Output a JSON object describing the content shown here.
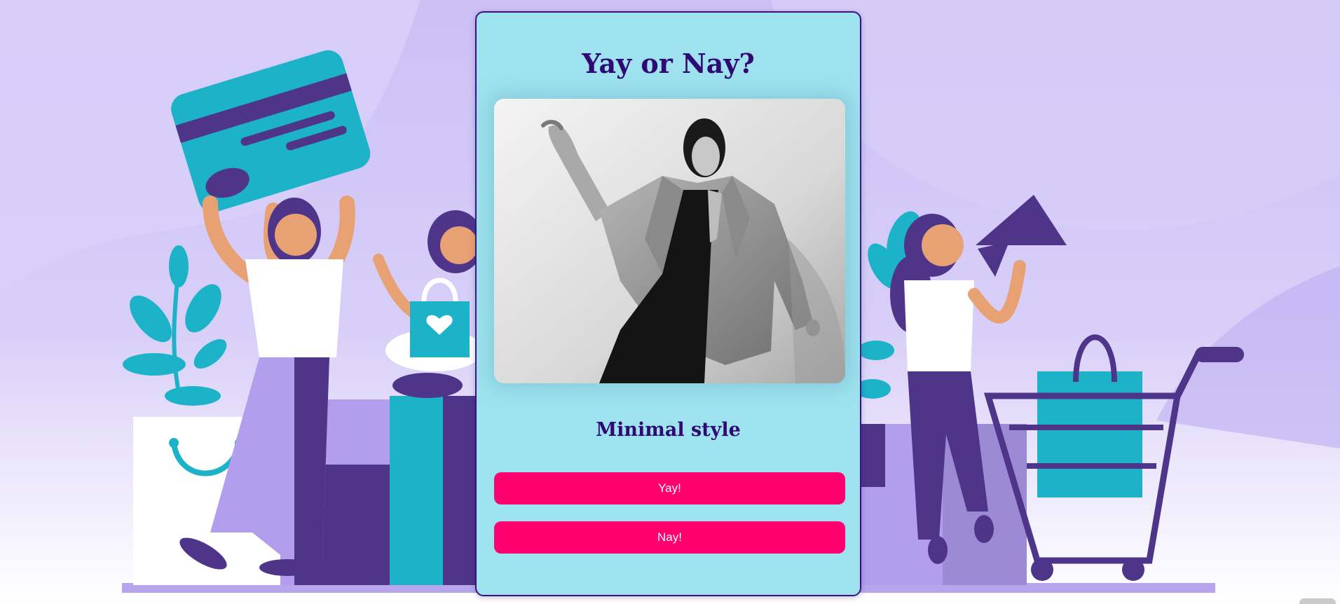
{
  "app": {
    "title": "Yay or Nay?"
  },
  "card": {
    "photo_icon": "person-in-blazer-photo",
    "style_name": "Minimal style",
    "yay_label": "Yay!",
    "nay_label": "Nay!"
  },
  "colors": {
    "background": "#cbc0f6",
    "card": "#9ee1ef",
    "card_border": "#3a127f",
    "title_text": "#2f0a73",
    "button": "#ff006e",
    "button_text": "#ffffff",
    "illustration_purple": "#4e3589",
    "illustration_teal": "#1cb2c8",
    "illustration_lavender": "#b39ded"
  },
  "illustration": {
    "left_icons": [
      "credit-card-icon",
      "plant-icon",
      "shopping-bag-icon",
      "woman-figure-icon"
    ],
    "right_icons": [
      "megaphone-icon",
      "woman-figure-icon",
      "shopping-cart-icon",
      "plant-icon"
    ]
  }
}
